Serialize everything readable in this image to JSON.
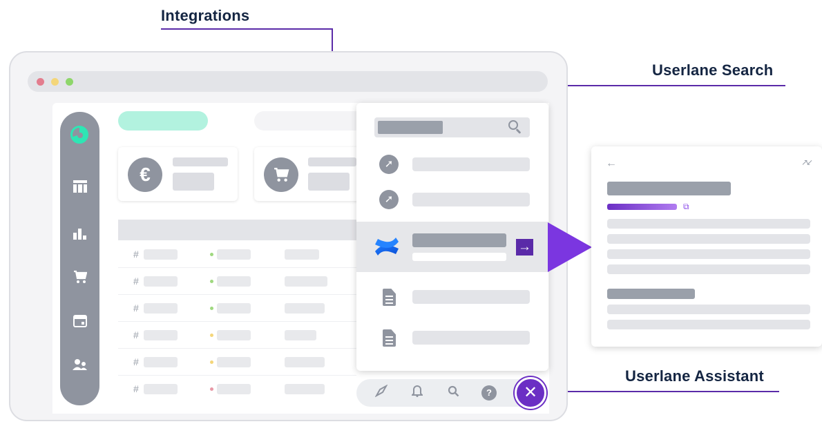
{
  "callouts": {
    "integrations": "Integrations",
    "search": "Userlane Search",
    "assistant": "Userlane Assistant"
  },
  "browser": {
    "traffic_lights": [
      "#e37d8e",
      "#f4d67a",
      "#8ed66b"
    ]
  },
  "sidebar": {
    "items": [
      {
        "name": "logo-icon"
      },
      {
        "name": "table-icon",
        "glyph": "▦"
      },
      {
        "name": "bar-chart-icon",
        "glyph": "▮"
      },
      {
        "name": "cart-icon",
        "glyph": "🛒"
      },
      {
        "name": "calendar-icon",
        "glyph": "▣"
      },
      {
        "name": "users-icon",
        "glyph": "👥"
      }
    ]
  },
  "stats": {
    "euro_symbol": "€",
    "cart_symbol": "🛒"
  },
  "table": {
    "row_marker": "#",
    "status_colors": [
      "#9fd87f",
      "#9fd87f",
      "#9fd87f",
      "#f4d67a",
      "#f4d67a",
      "#e898a6"
    ]
  },
  "assistant_panel": {
    "results": [
      {
        "icon": "compass-icon"
      },
      {
        "icon": "compass-icon"
      },
      {
        "icon": "confluence-icon",
        "selected": true
      },
      {
        "icon": "document-icon"
      },
      {
        "icon": "document-icon"
      }
    ],
    "open_arrow": "→"
  },
  "bottom_bar": {
    "icons": [
      "compass-icon",
      "bell-icon",
      "search-icon",
      "help-icon"
    ],
    "help_glyph": "?",
    "close_glyph": "✕"
  },
  "detail_card": {
    "back_glyph": "←",
    "collapse_glyph": "↗↙",
    "external_glyph": "⧉"
  },
  "colors": {
    "accent": "#6b2fc4",
    "brand_teal": "#2ee6b4",
    "sidebar": "#8f949f",
    "callout_text": "#142542"
  }
}
